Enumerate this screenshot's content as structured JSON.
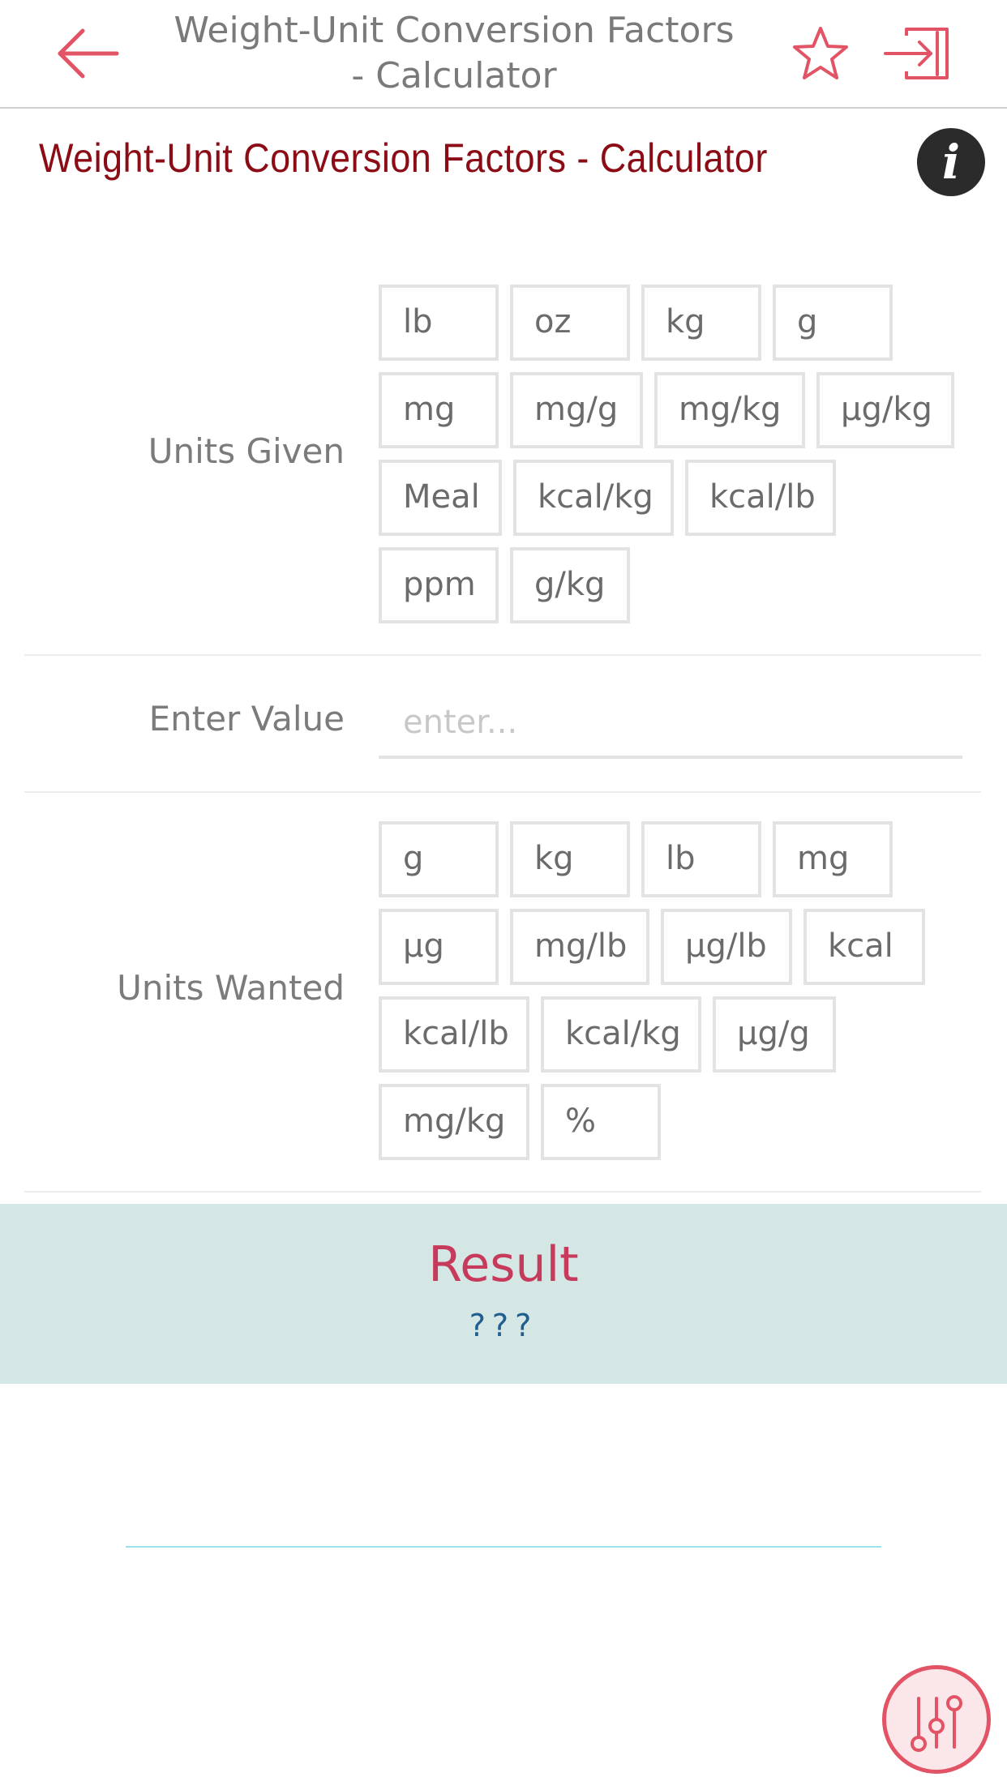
{
  "nav": {
    "title_line1": "Weight-Unit Conversion Factors",
    "title_line2": "- Calculator"
  },
  "page": {
    "heading": "Weight-Unit Conversion Factors - Calculator"
  },
  "units_given": {
    "label": "Units Given",
    "rows": [
      [
        "lb",
        "oz",
        "kg",
        "g"
      ],
      [
        "mg",
        "mg/g",
        "mg/kg",
        "μg/kg"
      ],
      [
        "Meal",
        "kcal/kg",
        "kcal/lb"
      ],
      [
        "ppm",
        "g/kg"
      ]
    ]
  },
  "enter_value": {
    "label": "Enter Value",
    "placeholder": "enter...",
    "value": ""
  },
  "units_wanted": {
    "label": "Units Wanted",
    "rows": [
      [
        "g",
        "kg",
        "lb",
        "mg"
      ],
      [
        "μg",
        "mg/lb",
        "μg/lb",
        "kcal"
      ],
      [
        "kcal/lb",
        "kcal/kg",
        "μg/g"
      ],
      [
        "mg/kg",
        "%"
      ]
    ]
  },
  "result": {
    "title": "Result",
    "value": "???"
  },
  "colors": {
    "accent": "#e25465",
    "heading": "#8b0c15",
    "result_bg": "#d4e7e5",
    "result_title": "#c83a5c",
    "result_value": "#1f5e8e"
  },
  "icons": {
    "back": "arrow-left-icon",
    "favorite": "star-icon",
    "exit": "sign-in-icon",
    "info": "info-icon",
    "settings": "sliders-icon"
  }
}
